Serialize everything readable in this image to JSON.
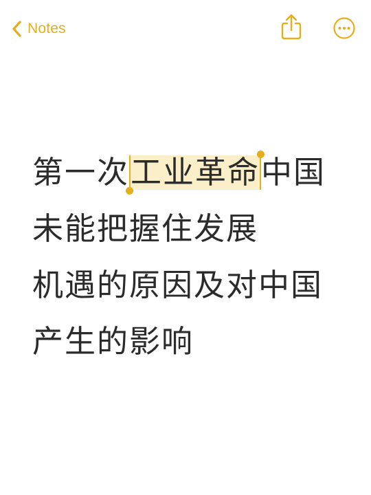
{
  "navbar": {
    "back_label": "Notes",
    "back_icon": "chevron-left-icon",
    "share_icon": "share-icon",
    "more_icon": "ellipsis-circle-icon",
    "accent_color": "#E5AE1C"
  },
  "note": {
    "line1_before": "第一次",
    "line1_selected": "工业革命",
    "line1_after": "中国",
    "line2": "未能把握住发展",
    "line3": "机遇的原因及对中国",
    "line4": "产生的影响",
    "selection_color": "#FBEFC9"
  }
}
